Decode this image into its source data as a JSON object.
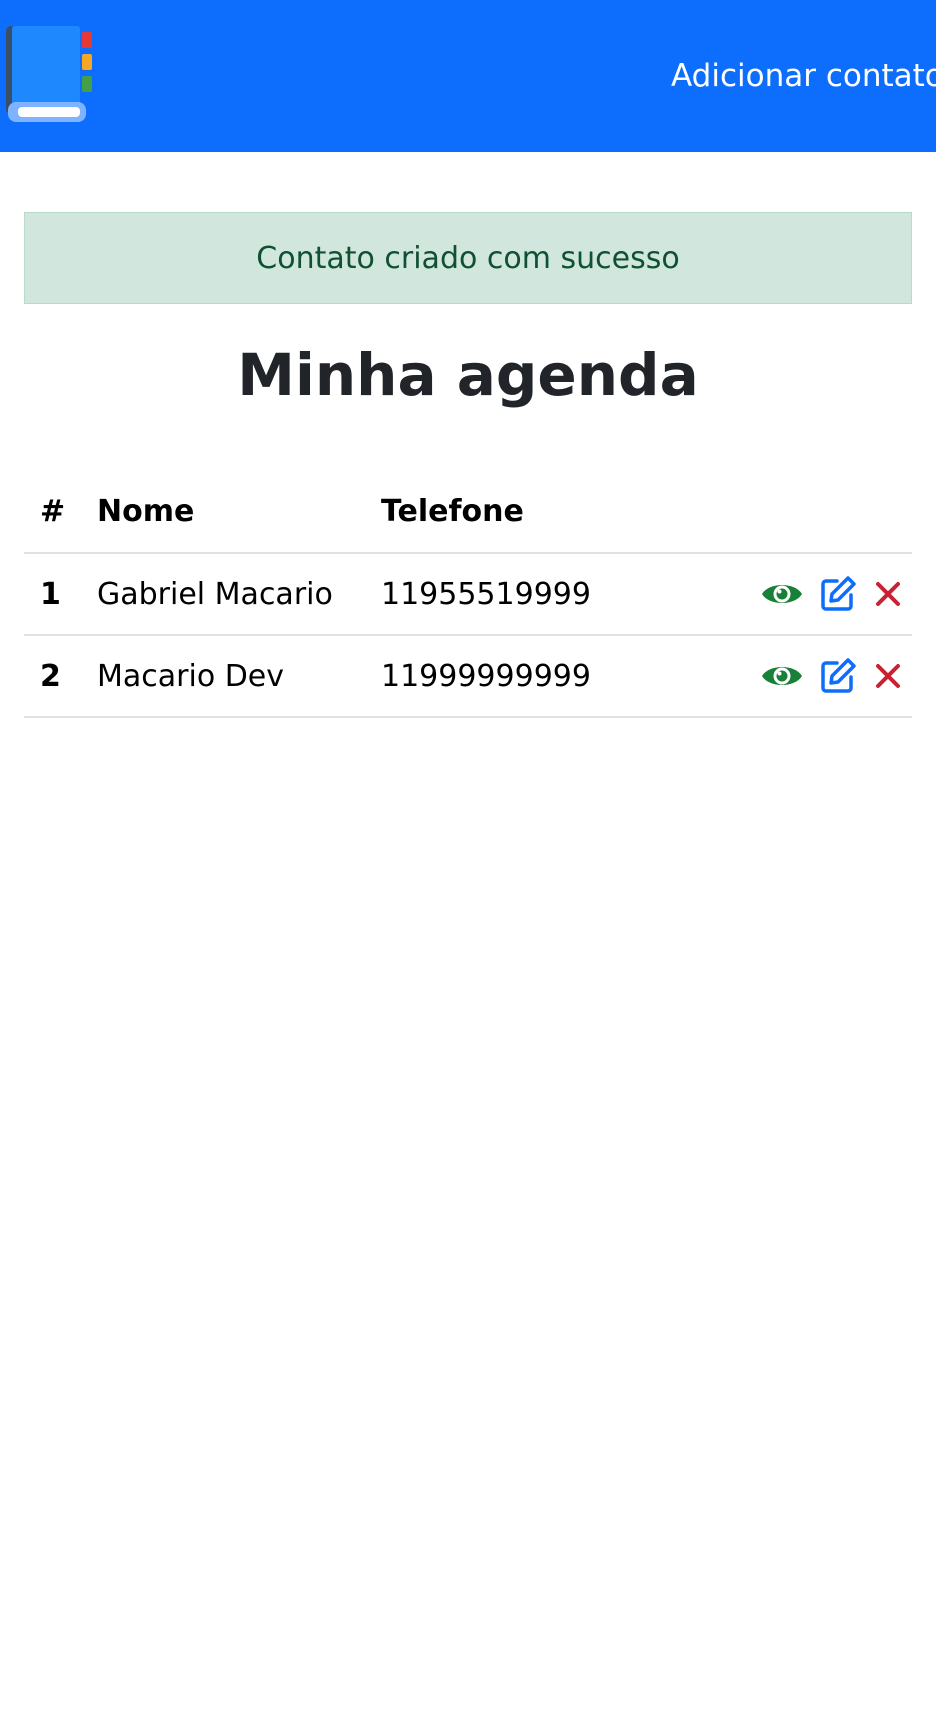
{
  "navbar": {
    "logo_icon": "address-book-icon",
    "add_contacts_label": "Adicionar contatos",
    "background_color": "#0d6efd"
  },
  "alert": {
    "message": "Contato criado com sucesso",
    "type": "success"
  },
  "page_title": "Minha agenda",
  "table": {
    "headers": {
      "id": "#",
      "name": "Nome",
      "phone": "Telefone"
    },
    "rows": [
      {
        "id": "1",
        "name": "Gabriel Macario",
        "phone": "11955519999"
      },
      {
        "id": "2",
        "name": "Macario Dev",
        "phone": "11999999999"
      }
    ],
    "actions": {
      "view_icon": "eye-icon",
      "edit_icon": "edit-icon",
      "delete_icon": "close-icon",
      "view_color": "#198038",
      "edit_color": "#0d6efd",
      "delete_color": "#c82333"
    }
  }
}
